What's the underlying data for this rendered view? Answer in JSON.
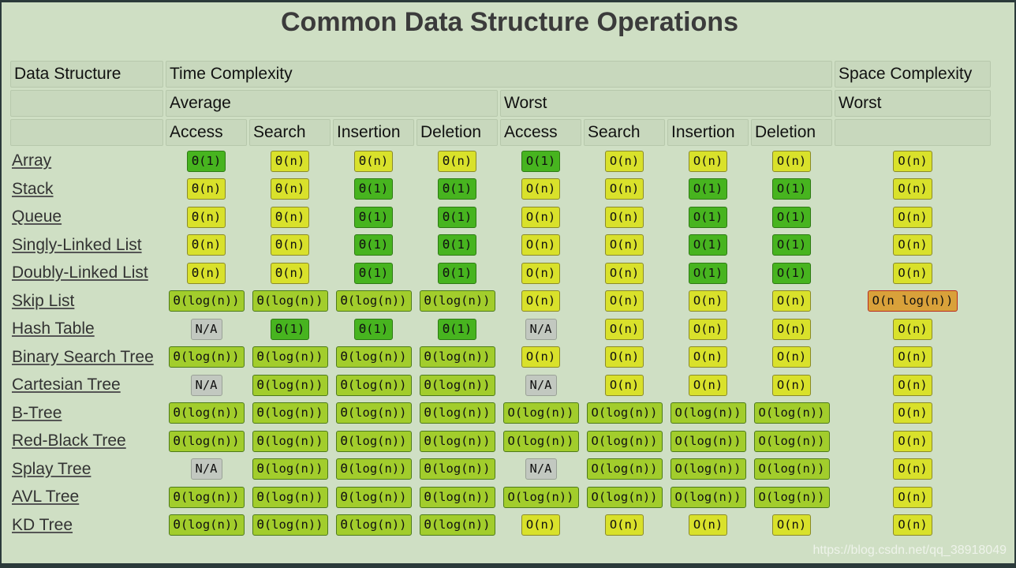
{
  "title": "Common Data Structure Operations",
  "header": {
    "row1": {
      "data_structure": "Data Structure",
      "time": "Time Complexity",
      "space": "Space Complexity"
    },
    "row2": {
      "avg": "Average",
      "worst": "Worst",
      "space_worst": "Worst"
    },
    "row3": [
      "Access",
      "Search",
      "Insertion",
      "Deletion",
      "Access",
      "Search",
      "Insertion",
      "Deletion"
    ]
  },
  "colors": {
    "green": "#47b41f",
    "yellow": "#d9e12b",
    "light_green": "#a2cd2c",
    "gray": "#c2c8c0",
    "orange": "#d9a13a"
  },
  "rows": [
    {
      "name": "Array",
      "cells": [
        [
          "Θ(1)",
          "green"
        ],
        [
          "Θ(n)",
          "yellow"
        ],
        [
          "Θ(n)",
          "yellow"
        ],
        [
          "Θ(n)",
          "yellow"
        ],
        [
          "O(1)",
          "green"
        ],
        [
          "O(n)",
          "yellow"
        ],
        [
          "O(n)",
          "yellow"
        ],
        [
          "O(n)",
          "yellow"
        ],
        [
          "O(n)",
          "yellow"
        ]
      ]
    },
    {
      "name": "Stack",
      "cells": [
        [
          "Θ(n)",
          "yellow"
        ],
        [
          "Θ(n)",
          "yellow"
        ],
        [
          "Θ(1)",
          "green"
        ],
        [
          "Θ(1)",
          "green"
        ],
        [
          "O(n)",
          "yellow"
        ],
        [
          "O(n)",
          "yellow"
        ],
        [
          "O(1)",
          "green"
        ],
        [
          "O(1)",
          "green"
        ],
        [
          "O(n)",
          "yellow"
        ]
      ]
    },
    {
      "name": "Queue",
      "cells": [
        [
          "Θ(n)",
          "yellow"
        ],
        [
          "Θ(n)",
          "yellow"
        ],
        [
          "Θ(1)",
          "green"
        ],
        [
          "Θ(1)",
          "green"
        ],
        [
          "O(n)",
          "yellow"
        ],
        [
          "O(n)",
          "yellow"
        ],
        [
          "O(1)",
          "green"
        ],
        [
          "O(1)",
          "green"
        ],
        [
          "O(n)",
          "yellow"
        ]
      ]
    },
    {
      "name": "Singly-Linked List",
      "cells": [
        [
          "Θ(n)",
          "yellow"
        ],
        [
          "Θ(n)",
          "yellow"
        ],
        [
          "Θ(1)",
          "green"
        ],
        [
          "Θ(1)",
          "green"
        ],
        [
          "O(n)",
          "yellow"
        ],
        [
          "O(n)",
          "yellow"
        ],
        [
          "O(1)",
          "green"
        ],
        [
          "O(1)",
          "green"
        ],
        [
          "O(n)",
          "yellow"
        ]
      ]
    },
    {
      "name": "Doubly-Linked List",
      "cells": [
        [
          "Θ(n)",
          "yellow"
        ],
        [
          "Θ(n)",
          "yellow"
        ],
        [
          "Θ(1)",
          "green"
        ],
        [
          "Θ(1)",
          "green"
        ],
        [
          "O(n)",
          "yellow"
        ],
        [
          "O(n)",
          "yellow"
        ],
        [
          "O(1)",
          "green"
        ],
        [
          "O(1)",
          "green"
        ],
        [
          "O(n)",
          "yellow"
        ]
      ]
    },
    {
      "name": "Skip List",
      "cells": [
        [
          "Θ(log(n))",
          "light_green"
        ],
        [
          "Θ(log(n))",
          "light_green"
        ],
        [
          "Θ(log(n))",
          "light_green"
        ],
        [
          "Θ(log(n))",
          "light_green"
        ],
        [
          "O(n)",
          "yellow"
        ],
        [
          "O(n)",
          "yellow"
        ],
        [
          "O(n)",
          "yellow"
        ],
        [
          "O(n)",
          "yellow"
        ],
        [
          "O(n log(n))",
          "orange"
        ]
      ]
    },
    {
      "name": "Hash Table",
      "cells": [
        [
          "N/A",
          "gray"
        ],
        [
          "Θ(1)",
          "green"
        ],
        [
          "Θ(1)",
          "green"
        ],
        [
          "Θ(1)",
          "green"
        ],
        [
          "N/A",
          "gray"
        ],
        [
          "O(n)",
          "yellow"
        ],
        [
          "O(n)",
          "yellow"
        ],
        [
          "O(n)",
          "yellow"
        ],
        [
          "O(n)",
          "yellow"
        ]
      ]
    },
    {
      "name": "Binary Search Tree",
      "cells": [
        [
          "Θ(log(n))",
          "light_green"
        ],
        [
          "Θ(log(n))",
          "light_green"
        ],
        [
          "Θ(log(n))",
          "light_green"
        ],
        [
          "Θ(log(n))",
          "light_green"
        ],
        [
          "O(n)",
          "yellow"
        ],
        [
          "O(n)",
          "yellow"
        ],
        [
          "O(n)",
          "yellow"
        ],
        [
          "O(n)",
          "yellow"
        ],
        [
          "O(n)",
          "yellow"
        ]
      ]
    },
    {
      "name": "Cartesian Tree",
      "cells": [
        [
          "N/A",
          "gray"
        ],
        [
          "Θ(log(n))",
          "light_green"
        ],
        [
          "Θ(log(n))",
          "light_green"
        ],
        [
          "Θ(log(n))",
          "light_green"
        ],
        [
          "N/A",
          "gray"
        ],
        [
          "O(n)",
          "yellow"
        ],
        [
          "O(n)",
          "yellow"
        ],
        [
          "O(n)",
          "yellow"
        ],
        [
          "O(n)",
          "yellow"
        ]
      ]
    },
    {
      "name": "B-Tree",
      "cells": [
        [
          "Θ(log(n))",
          "light_green"
        ],
        [
          "Θ(log(n))",
          "light_green"
        ],
        [
          "Θ(log(n))",
          "light_green"
        ],
        [
          "Θ(log(n))",
          "light_green"
        ],
        [
          "O(log(n))",
          "light_green"
        ],
        [
          "O(log(n))",
          "light_green"
        ],
        [
          "O(log(n))",
          "light_green"
        ],
        [
          "O(log(n))",
          "light_green"
        ],
        [
          "O(n)",
          "yellow"
        ]
      ]
    },
    {
      "name": "Red-Black Tree",
      "cells": [
        [
          "Θ(log(n))",
          "light_green"
        ],
        [
          "Θ(log(n))",
          "light_green"
        ],
        [
          "Θ(log(n))",
          "light_green"
        ],
        [
          "Θ(log(n))",
          "light_green"
        ],
        [
          "O(log(n))",
          "light_green"
        ],
        [
          "O(log(n))",
          "light_green"
        ],
        [
          "O(log(n))",
          "light_green"
        ],
        [
          "O(log(n))",
          "light_green"
        ],
        [
          "O(n)",
          "yellow"
        ]
      ]
    },
    {
      "name": "Splay Tree",
      "cells": [
        [
          "N/A",
          "gray"
        ],
        [
          "Θ(log(n))",
          "light_green"
        ],
        [
          "Θ(log(n))",
          "light_green"
        ],
        [
          "Θ(log(n))",
          "light_green"
        ],
        [
          "N/A",
          "gray"
        ],
        [
          "O(log(n))",
          "light_green"
        ],
        [
          "O(log(n))",
          "light_green"
        ],
        [
          "O(log(n))",
          "light_green"
        ],
        [
          "O(n)",
          "yellow"
        ]
      ]
    },
    {
      "name": "AVL Tree",
      "cells": [
        [
          "Θ(log(n))",
          "light_green"
        ],
        [
          "Θ(log(n))",
          "light_green"
        ],
        [
          "Θ(log(n))",
          "light_green"
        ],
        [
          "Θ(log(n))",
          "light_green"
        ],
        [
          "O(log(n))",
          "light_green"
        ],
        [
          "O(log(n))",
          "light_green"
        ],
        [
          "O(log(n))",
          "light_green"
        ],
        [
          "O(log(n))",
          "light_green"
        ],
        [
          "O(n)",
          "yellow"
        ]
      ]
    },
    {
      "name": "KD Tree",
      "cells": [
        [
          "Θ(log(n))",
          "light_green"
        ],
        [
          "Θ(log(n))",
          "light_green"
        ],
        [
          "Θ(log(n))",
          "light_green"
        ],
        [
          "Θ(log(n))",
          "light_green"
        ],
        [
          "O(n)",
          "yellow"
        ],
        [
          "O(n)",
          "yellow"
        ],
        [
          "O(n)",
          "yellow"
        ],
        [
          "O(n)",
          "yellow"
        ],
        [
          "O(n)",
          "yellow"
        ]
      ]
    }
  ],
  "watermark": "https://blog.csdn.net/qq_38918049"
}
